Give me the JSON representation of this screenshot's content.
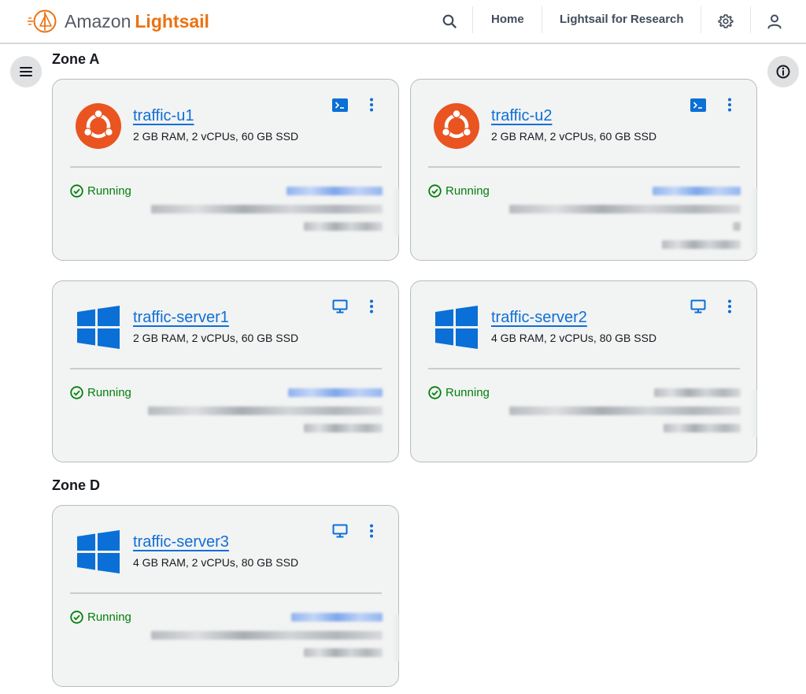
{
  "header": {
    "brand_prefix": "Amazon",
    "brand_name": "Lightsail",
    "nav": [
      {
        "label": "Home"
      },
      {
        "label": "Lightsail for Research"
      }
    ]
  },
  "icons": {
    "menu": "hamburger-menu-icon",
    "info": "info-icon",
    "search": "search-icon",
    "settings": "gear-icon",
    "account": "user-icon"
  },
  "colors": {
    "brand_orange": "#ec7211",
    "link_blue": "#0f6fd6",
    "running_green": "#037f0c",
    "ubuntu_orange": "#e95420",
    "windows_blue": "#0a6fd6"
  },
  "zones": [
    {
      "title": "Zone A",
      "instances": [
        {
          "name": "traffic-u1",
          "spec": "2 GB RAM, 2 vCPUs, 60 GB SSD",
          "os": "ubuntu",
          "connect": "ssh-terminal-icon",
          "status": "Running"
        },
        {
          "name": "traffic-u2",
          "spec": "2 GB RAM, 2 vCPUs, 60 GB SSD",
          "os": "ubuntu",
          "connect": "ssh-terminal-icon",
          "status": "Running"
        },
        {
          "name": "traffic-server1",
          "spec": "2 GB RAM, 2 vCPUs, 60 GB SSD",
          "os": "windows",
          "connect": "rdp-monitor-icon",
          "status": "Running"
        },
        {
          "name": "traffic-server2",
          "spec": "4 GB RAM, 2 vCPUs, 80 GB SSD",
          "os": "windows",
          "connect": "rdp-monitor-icon",
          "status": "Running"
        }
      ]
    },
    {
      "title": "Zone D",
      "instances": [
        {
          "name": "traffic-server3",
          "spec": "4 GB RAM, 2 vCPUs, 80 GB SSD",
          "os": "windows",
          "connect": "rdp-monitor-icon",
          "status": "Running"
        }
      ]
    }
  ]
}
